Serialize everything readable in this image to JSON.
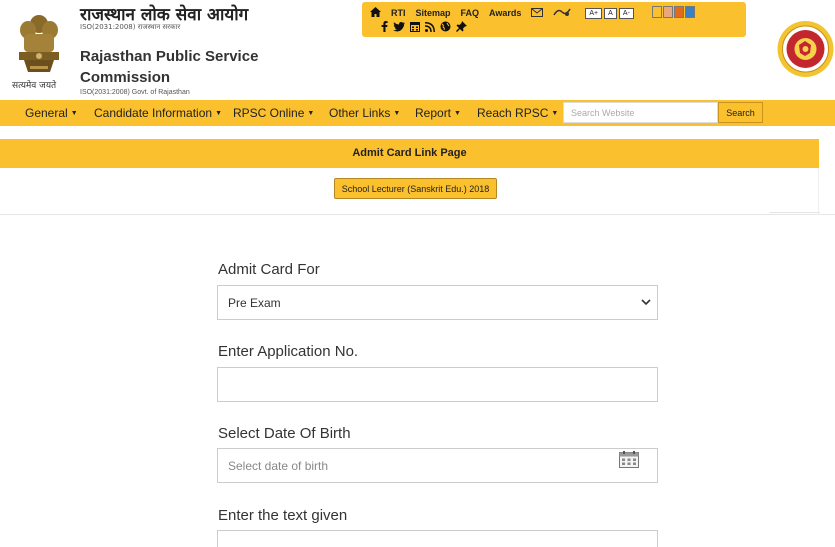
{
  "header": {
    "title_hindi": "राजस्थान लोक सेवा आयोग",
    "iso_hindi": "ISO(2031:2008) राजस्थान सरकार",
    "title_english": "Rajasthan Public Service Commission",
    "iso_english": "ISO(2031:2008) Govt. of Rajasthan",
    "emblem_motto": "सत्यमेव जयते"
  },
  "utility_bar": {
    "links": [
      "RTI",
      "Sitemap",
      "FAQ",
      "Awards"
    ],
    "font_sizes": [
      "A+",
      "A",
      "A-"
    ],
    "theme_colors": [
      "#fbc02d",
      "#e8a87c",
      "#e06a1e",
      "#3b7fc4"
    ],
    "social_icons": [
      "facebook-icon",
      "twitter-icon",
      "calendar-icon",
      "rss-icon",
      "globe-icon",
      "pin-icon"
    ]
  },
  "nav": {
    "items": [
      {
        "label": "General"
      },
      {
        "label": "Candidate Information"
      },
      {
        "label": "RPSC Online"
      },
      {
        "label": "Other Links"
      },
      {
        "label": "Report"
      },
      {
        "label": "Reach RPSC"
      }
    ],
    "search_placeholder": "Search Website",
    "search_button": "Search"
  },
  "page": {
    "banner_title": "Admit Card Link Page",
    "exam_button": "School Lecturer (Sanskrit Edu.) 2018"
  },
  "form": {
    "admit_card_label": "Admit Card For",
    "admit_card_value": "Pre Exam",
    "application_label": "Enter Application No.",
    "application_value": "",
    "dob_label": "Select Date Of Birth",
    "dob_placeholder": "Select date of birth",
    "captcha_label": "Enter the text given"
  },
  "colors": {
    "accent": "#fbc02d",
    "text": "#222222"
  }
}
